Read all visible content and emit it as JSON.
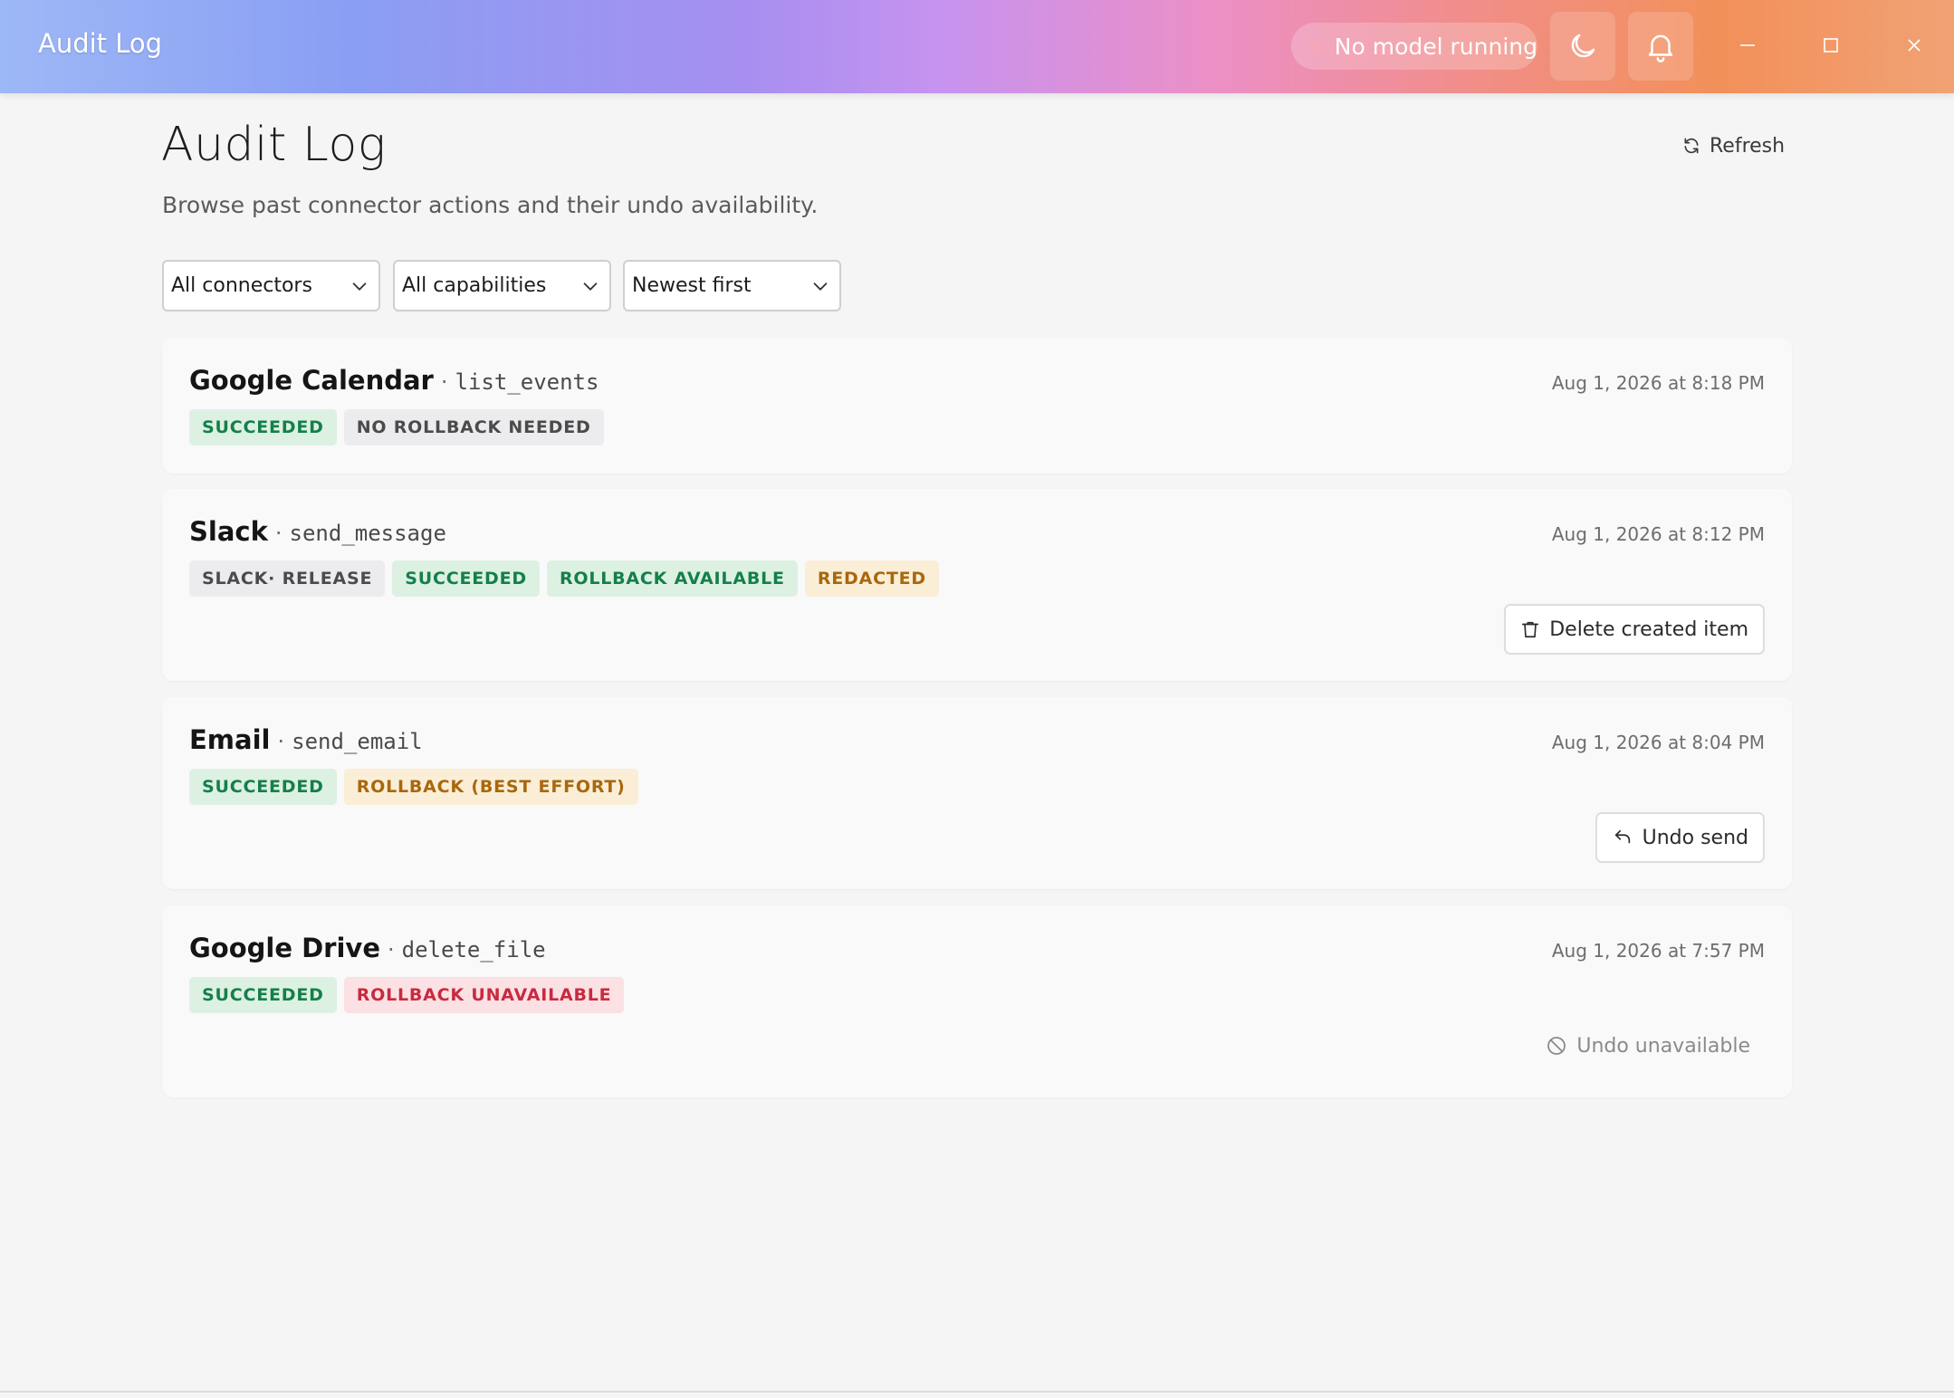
{
  "window": {
    "title": "Audit Log",
    "status_text": "No model running"
  },
  "header": {
    "title": "Audit Log",
    "subtitle": "Browse past connector actions and their undo availability.",
    "refresh_label": "Refresh"
  },
  "filters": {
    "connector": "All connectors",
    "capability": "All capabilities",
    "sort": "Newest first"
  },
  "entries": [
    {
      "connector": "Google Calendar",
      "capability": "list_events",
      "timestamp": "Aug 1, 2026 at 8:18 PM",
      "badges": [
        {
          "label": "SUCCEEDED",
          "kind": "success"
        },
        {
          "label": "NO ROLLBACK NEEDED",
          "kind": "neutral"
        }
      ]
    },
    {
      "connector": "Slack",
      "capability": "send_message",
      "timestamp": "Aug 1, 2026 at 8:12 PM",
      "badges": [
        {
          "label": "SLACK· RELEASE",
          "kind": "neutral"
        },
        {
          "label": "SUCCEEDED",
          "kind": "success"
        },
        {
          "label": "ROLLBACK AVAILABLE",
          "kind": "success"
        },
        {
          "label": "REDACTED",
          "kind": "warn"
        }
      ],
      "action": {
        "label": "Delete created item",
        "icon": "trash-icon"
      }
    },
    {
      "connector": "Email",
      "capability": "send_email",
      "timestamp": "Aug 1, 2026 at 8:04 PM",
      "badges": [
        {
          "label": "SUCCEEDED",
          "kind": "success"
        },
        {
          "label": "ROLLBACK (BEST EFFORT)",
          "kind": "warn"
        }
      ],
      "action": {
        "label": "Undo send",
        "icon": "undo-icon"
      }
    },
    {
      "connector": "Google Drive",
      "capability": "delete_file",
      "timestamp": "Aug 1, 2026 at 7:57 PM",
      "badges": [
        {
          "label": "SUCCEEDED",
          "kind": "success"
        },
        {
          "label": "ROLLBACK UNAVAILABLE",
          "kind": "danger"
        }
      ],
      "action": {
        "label": "Undo unavailable",
        "icon": "ban-icon"
      }
    }
  ],
  "colors": {
    "success": "#157f4b",
    "warn": "#a8680d",
    "danger": "#c92a40",
    "neutral": "#4b4b4b"
  }
}
